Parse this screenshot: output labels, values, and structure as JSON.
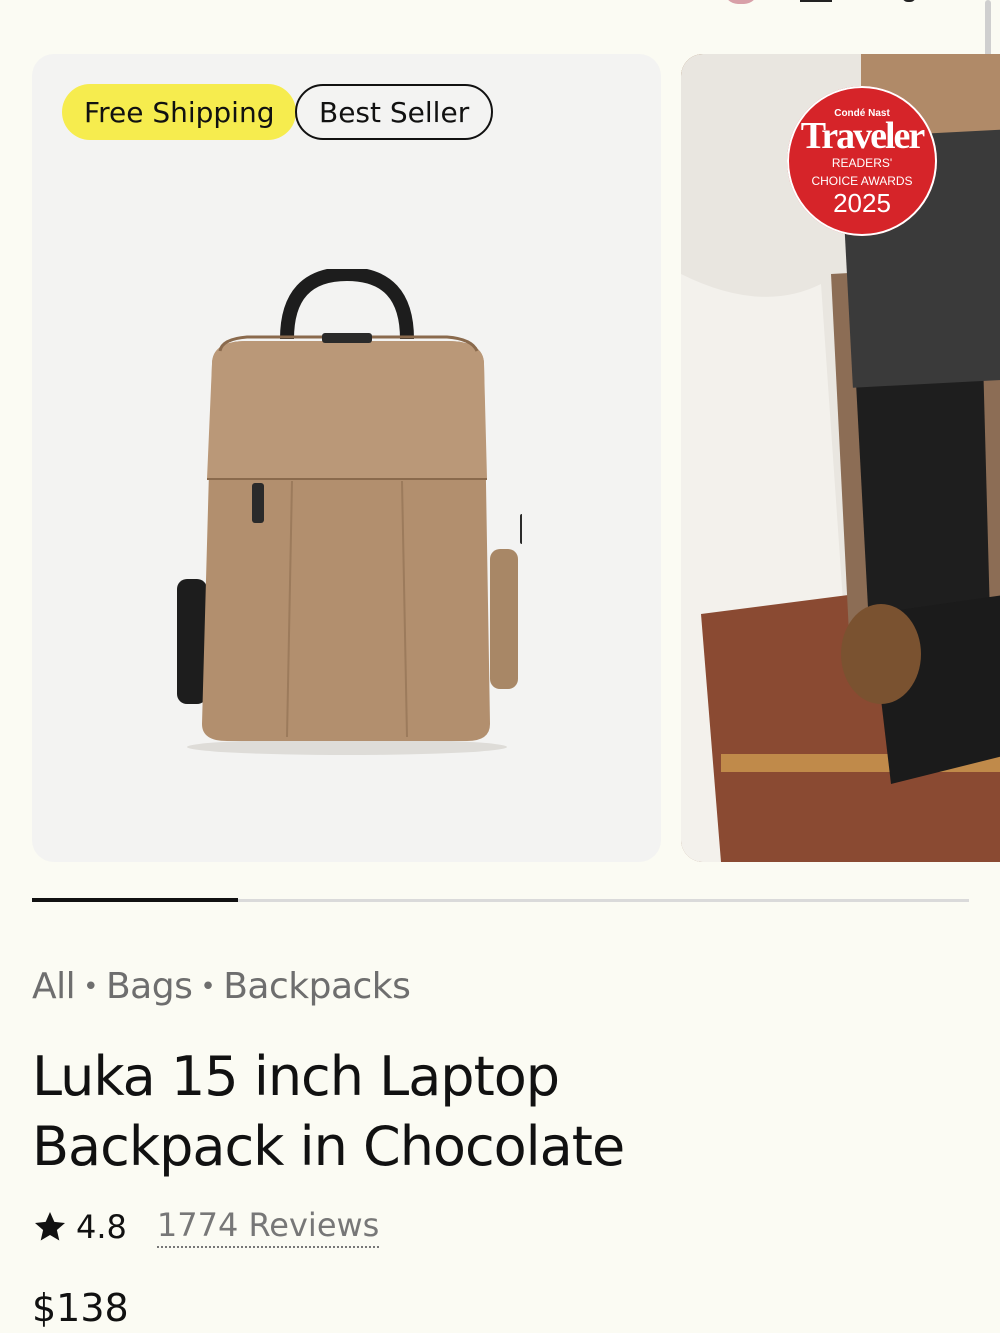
{
  "badges": {
    "free_shipping": "Free Shipping",
    "best_seller": "Best Seller"
  },
  "award": {
    "top": "Condé Nast",
    "title": "Traveler",
    "line1": "READERS'",
    "line2": "CHOICE AWARDS",
    "year": "2025"
  },
  "gallery": {
    "progress_fraction": 0.22
  },
  "breadcrumb": {
    "items": [
      "All",
      "Bags",
      "Backpacks"
    ],
    "separator": "•"
  },
  "product": {
    "title": "Luka 15 inch Laptop Backpack in Chocolate",
    "rating": "4.8",
    "reviews": "1774 Reviews",
    "price": "$138"
  },
  "colors": {
    "free_badge": "#f6ec4e",
    "background": "#fbfbf3",
    "award_red": "#d62429"
  },
  "icons": {
    "rating": "star-icon"
  }
}
